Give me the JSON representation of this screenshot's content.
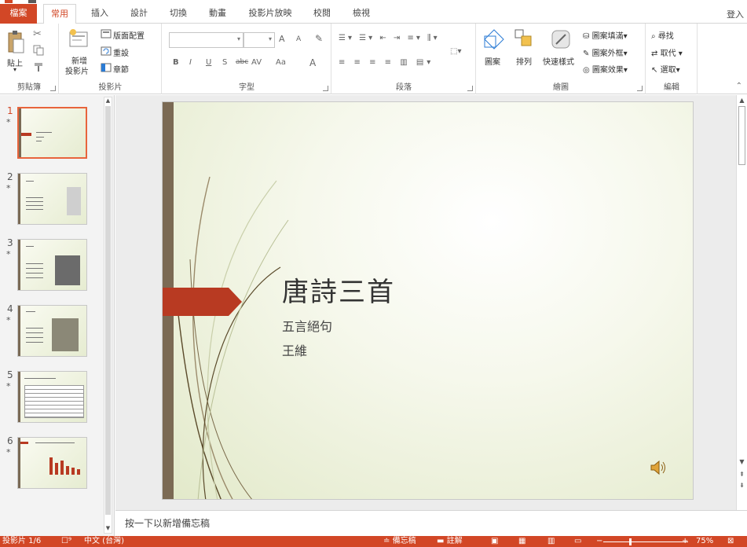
{
  "tabs": [
    {
      "label": "檔案"
    },
    {
      "label": "常用"
    },
    {
      "label": "插入"
    },
    {
      "label": "設計"
    },
    {
      "label": "切換"
    },
    {
      "label": "動畫"
    },
    {
      "label": "投影片放映"
    },
    {
      "label": "校閱"
    },
    {
      "label": "檢視"
    }
  ],
  "signin": "登入",
  "ribbon": {
    "clipboard": {
      "label": "剪貼簿",
      "paste": "貼上"
    },
    "slides": {
      "label": "投影片",
      "new_slide_1": "新增",
      "new_slide_2": "投影片",
      "layout": "版面配置",
      "reset": "重設",
      "section": "章節"
    },
    "font": {
      "label": "字型",
      "bold": "B",
      "italic": "I",
      "underline": "U",
      "shadow": "S",
      "strike": "abc",
      "spacing": "AV",
      "case": "Aa",
      "color": "A",
      "grow": "A",
      "shrink": "A"
    },
    "paragraph": {
      "label": "段落"
    },
    "drawing": {
      "label": "繪圖",
      "shapes": "圖案",
      "arrange": "排列",
      "quick_styles": "快速樣式",
      "fill": "圖案填滿",
      "outline": "圖案外框",
      "effects": "圖案效果"
    },
    "editing": {
      "label": "編輯",
      "find": "尋找",
      "replace": "取代",
      "select": "選取"
    }
  },
  "thumbnails": [
    {
      "num": "1",
      "star": "*"
    },
    {
      "num": "2",
      "star": "*"
    },
    {
      "num": "3",
      "star": "*"
    },
    {
      "num": "4",
      "star": "*"
    },
    {
      "num": "5",
      "star": "*"
    },
    {
      "num": "6",
      "star": "*"
    }
  ],
  "slide": {
    "title": "唐詩三首",
    "subtitle1": "五言絕句",
    "subtitle2": "王維"
  },
  "notes_placeholder": "按一下以新增備忘稿",
  "status": {
    "slide_info": "投影片 1/6",
    "language": "中文 (台灣)",
    "notes": "備忘稿",
    "comments": "註解",
    "zoom": "75%"
  },
  "colors": {
    "accent": "#d24726",
    "slide_bar": "#7b6a54",
    "slide_arrow": "#b83a22"
  }
}
